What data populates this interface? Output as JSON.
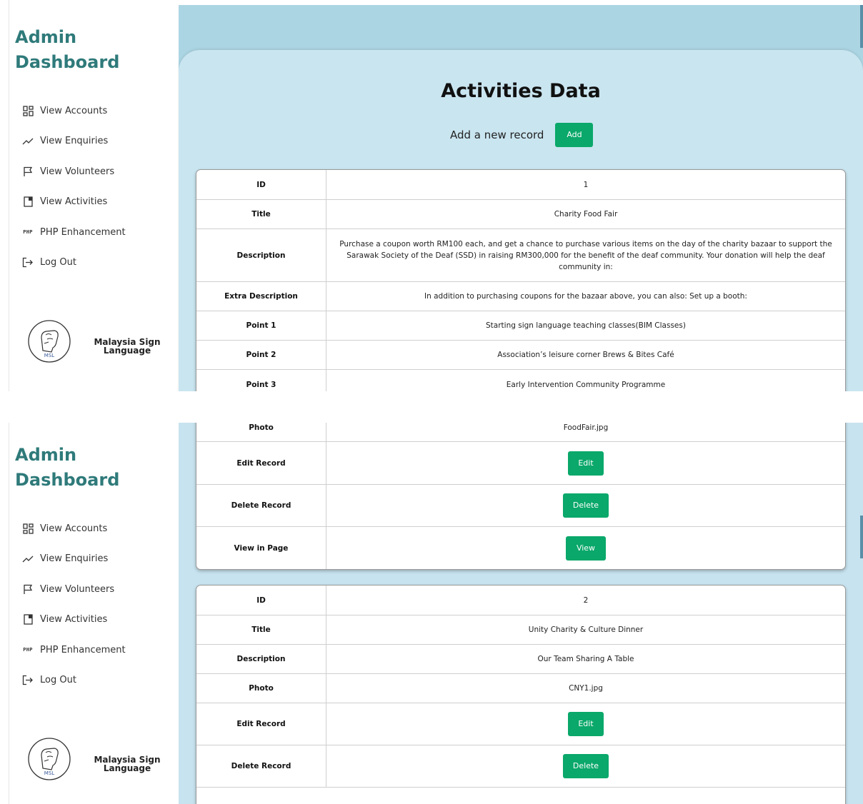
{
  "sidebar": {
    "title_line1": "Admin",
    "title_line2": "Dashboard",
    "items": [
      {
        "label": "View Accounts",
        "icon": "grid-icon"
      },
      {
        "label": "View Enquiries",
        "icon": "trend-icon"
      },
      {
        "label": "View Volunteers",
        "icon": "flag-icon"
      },
      {
        "label": "View Activities",
        "icon": "document-icon"
      },
      {
        "label": "PHP Enhancement",
        "icon": "php-icon",
        "icon_text": "PHP"
      },
      {
        "label": "Log Out",
        "icon": "logout-icon"
      }
    ],
    "logo_text_line1": "Malaysia Sign",
    "logo_text_line2": "Language",
    "logo_mark": "MSL"
  },
  "main": {
    "title": "Activities Data",
    "add_label": "Add a new record",
    "add_button": "Add"
  },
  "labels": {
    "id": "ID",
    "title": "Title",
    "description": "Description",
    "extra_description": "Extra Description",
    "point1": "Point 1",
    "point2": "Point 2",
    "point3": "Point 3",
    "photo": "Photo",
    "edit_record": "Edit Record",
    "delete_record": "Delete Record",
    "view_in_page": "View in Page"
  },
  "buttons": {
    "edit": "Edit",
    "delete": "Delete",
    "view": "View"
  },
  "records": [
    {
      "id": "1",
      "title": "Charity Food Fair",
      "description": "Purchase a coupon worth RM100 each, and get a chance to purchase various items on the day of the charity bazaar to support the Sarawak Society of the Deaf (SSD) in raising RM300,000 for the benefit of the deaf community. Your donation will help the deaf community in:",
      "extra_description": "In addition to purchasing coupons for the bazaar above, you can also: Set up a booth:",
      "point1": "Starting sign language teaching classes(BIM Classes)",
      "point2": "Association’s leisure corner Brews & Bites Café",
      "point3": "Early Intervention Community Programme",
      "photo": "FoodFair.jpg"
    },
    {
      "id": "2",
      "title": "Unity Charity & Culture Dinner",
      "description": "Our Team Sharing A Table",
      "photo": "CNY1.jpg"
    }
  ],
  "colors": {
    "brand": "#2f7a7a",
    "accent_button": "#0aa86a",
    "panel_bg": "#c9e5f0"
  }
}
